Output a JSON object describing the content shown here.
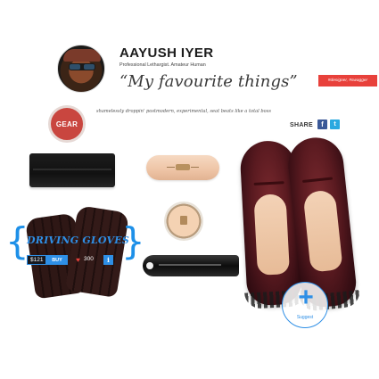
{
  "profile": {
    "name": "AAYUSH IYER",
    "tagline": "Professional Lethargist. Amateur Human",
    "collection_title": "“My favourite things”",
    "hashtags": "#designer, #swagger"
  },
  "category": {
    "label": "GEAR",
    "description": "shamelessly droppin' postmodern, experimental, seat beats like a total boss"
  },
  "share": {
    "label": "SHARE",
    "facebook_icon": "f",
    "twitter_icon": "t"
  },
  "featured_product": {
    "title": "DRIVING GLOVES",
    "price": "$121",
    "buy_label": "BUY",
    "like_icon": "♥",
    "likes": "300",
    "info_icon": "i"
  },
  "suggest": {
    "icon": "+",
    "label": "Suggest"
  },
  "colors": {
    "accent_blue": "#2e8fe6",
    "badge_red": "#e8413b",
    "gear_red": "#c9463f",
    "facebook": "#3b5998",
    "twitter": "#2aa9e0"
  }
}
